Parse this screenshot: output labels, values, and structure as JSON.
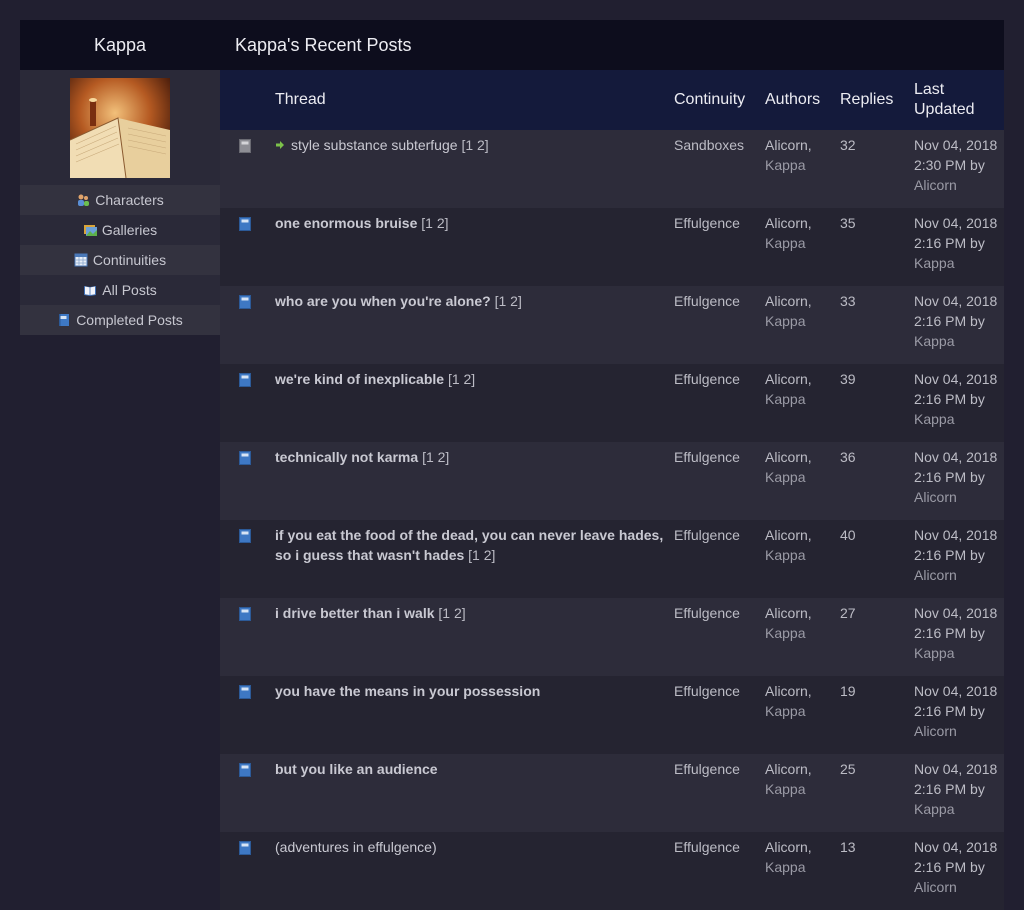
{
  "sidebar": {
    "title": "Kappa",
    "items": [
      {
        "label": "Characters",
        "icon": "characters-icon"
      },
      {
        "label": "Galleries",
        "icon": "gallery-icon"
      },
      {
        "label": "Continuities",
        "icon": "table-icon"
      },
      {
        "label": "All Posts",
        "icon": "open-book-icon"
      },
      {
        "label": "Completed Posts",
        "icon": "blue-book-icon"
      }
    ]
  },
  "main": {
    "title": "Kappa's Recent Posts",
    "headers": {
      "thread": "Thread",
      "continuity": "Continuity",
      "authors": "Authors",
      "replies": "Replies",
      "last_updated_1": "Last",
      "last_updated_2": "Updated"
    },
    "rows": [
      {
        "title": "style substance subterfuge",
        "pages": "[1 2]",
        "continuity": "Sandboxes",
        "author1": "Alicorn,",
        "author2": "Kappa",
        "replies": "32",
        "date": "Nov 04, 2018",
        "time": "2:30 PM by",
        "by": "Alicorn",
        "icon": "grey-book-icon",
        "unread_arrow": true,
        "bold": false
      },
      {
        "title": "one enormous bruise",
        "pages": "[1 2]",
        "continuity": "Effulgence",
        "author1": "Alicorn,",
        "author2": "Kappa",
        "replies": "35",
        "date": "Nov 04, 2018",
        "time": "2:16 PM by",
        "by": "Kappa",
        "icon": "blue-book-icon",
        "bold": true
      },
      {
        "title": "who are you when you're alone?",
        "pages": "[1 2]",
        "continuity": "Effulgence",
        "author1": "Alicorn,",
        "author2": "Kappa",
        "replies": "33",
        "date": "Nov 04, 2018",
        "time": "2:16 PM by",
        "by": "Kappa",
        "icon": "blue-book-icon",
        "bold": true
      },
      {
        "title": "we're kind of inexplicable",
        "pages": "[1 2]",
        "continuity": "Effulgence",
        "author1": "Alicorn,",
        "author2": "Kappa",
        "replies": "39",
        "date": "Nov 04, 2018",
        "time": "2:16 PM by",
        "by": "Kappa",
        "icon": "blue-book-icon",
        "bold": true
      },
      {
        "title": "technically not karma",
        "pages": "[1 2]",
        "continuity": "Effulgence",
        "author1": "Alicorn,",
        "author2": "Kappa",
        "replies": "36",
        "date": "Nov 04, 2018",
        "time": "2:16 PM by",
        "by": "Alicorn",
        "icon": "blue-book-icon",
        "bold": true
      },
      {
        "title": "if you eat the food of the dead, you can never leave hades, so i guess that wasn't hades",
        "pages": "[1 2]",
        "continuity": "Effulgence",
        "author1": "Alicorn,",
        "author2": "Kappa",
        "replies": "40",
        "date": "Nov 04, 2018",
        "time": "2:16 PM by",
        "by": "Alicorn",
        "icon": "blue-book-icon",
        "bold": true
      },
      {
        "title": "i drive better than i walk",
        "pages": "[1 2]",
        "continuity": "Effulgence",
        "author1": "Alicorn,",
        "author2": "Kappa",
        "replies": "27",
        "date": "Nov 04, 2018",
        "time": "2:16 PM by",
        "by": "Kappa",
        "icon": "blue-book-icon",
        "bold": true
      },
      {
        "title": "you have the means in your possession",
        "pages": "",
        "continuity": "Effulgence",
        "author1": "Alicorn,",
        "author2": "Kappa",
        "replies": "19",
        "date": "Nov 04, 2018",
        "time": "2:16 PM by",
        "by": "Alicorn",
        "icon": "blue-book-icon",
        "bold": true
      },
      {
        "title": "but you like an audience",
        "pages": "",
        "continuity": "Effulgence",
        "author1": "Alicorn,",
        "author2": "Kappa",
        "replies": "25",
        "date": "Nov 04, 2018",
        "time": "2:16 PM by",
        "by": "Kappa",
        "icon": "blue-book-icon",
        "bold": true
      },
      {
        "title": "(adventures in effulgence)",
        "pages": "",
        "continuity": "Effulgence",
        "author1": "Alicorn,",
        "author2": "Kappa",
        "replies": "13",
        "date": "Nov 04, 2018",
        "time": "2:16 PM by",
        "by": "Alicorn",
        "icon": "blue-book-icon",
        "bold": false
      }
    ]
  },
  "colors": {
    "background": "#211f30",
    "header_bar": "#0d0d1d",
    "table_header": "#141a3b",
    "row_a": "#2d2c3a",
    "row_b": "#252431",
    "unread_arrow": "#7cc24a"
  }
}
